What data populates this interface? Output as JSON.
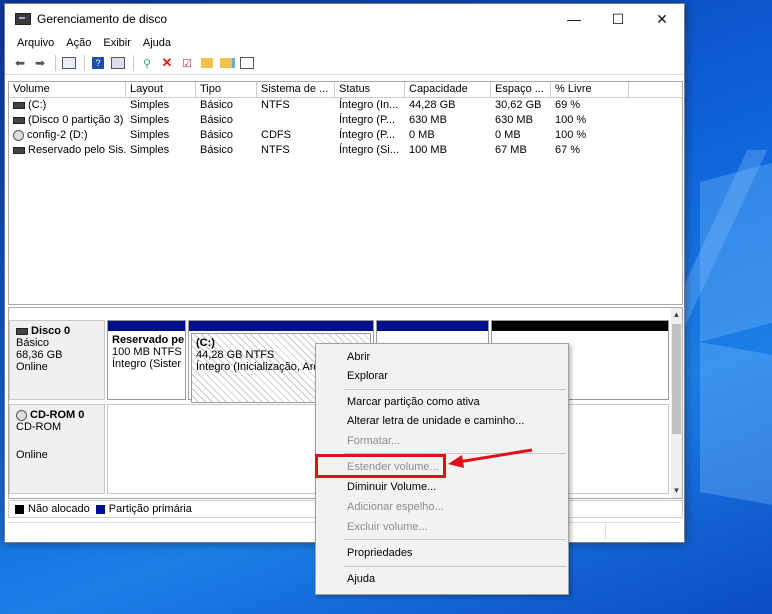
{
  "window": {
    "title": "Gerenciamento de disco",
    "controls": {
      "minimize": "—",
      "maximize": "☐",
      "close": "✕"
    }
  },
  "menubar": [
    "Arquivo",
    "Ação",
    "Exibir",
    "Ajuda"
  ],
  "table": {
    "headers": [
      "Volume",
      "Layout",
      "Tipo",
      "Sistema de ...",
      "Status",
      "Capacidade",
      "Espaço ...",
      "% Livre"
    ],
    "rows": [
      [
        "(C:)",
        "Simples",
        "Básico",
        "NTFS",
        "Íntegro (In...",
        "44,28 GB",
        "30,62 GB",
        "69 %"
      ],
      [
        "(Disco 0 partição 3)",
        "Simples",
        "Básico",
        "",
        "Íntegro (P...",
        "630 MB",
        "630 MB",
        "100 %"
      ],
      [
        "config-2 (D:)",
        "Simples",
        "Básico",
        "CDFS",
        "Íntegro (P...",
        "0 MB",
        "0 MB",
        "100 %"
      ],
      [
        "Reservado pelo Sis...",
        "Simples",
        "Básico",
        "NTFS",
        "Íntegro (Si...",
        "100 MB",
        "67 MB",
        "67 %"
      ]
    ]
  },
  "disks": {
    "disk0": {
      "name": "Disco 0",
      "type": "Básico",
      "size": "68,36 GB",
      "state": "Online",
      "partitions": {
        "reserved": {
          "title": "Reservado pe",
          "size": "100 MB NTFS",
          "status": "Íntegro (Sister"
        },
        "c": {
          "title": "(C:)",
          "size": "44,28 GB NTFS",
          "status": "Íntegro (Inicialização, Arqu"
        }
      }
    },
    "cdrom0": {
      "name": "CD-ROM 0",
      "type": "CD-ROM",
      "state": "Online"
    }
  },
  "legend": {
    "unallocated": "Não alocado",
    "primary": "Partição primária"
  },
  "context_menu": {
    "abrir": "Abrir",
    "explorar": "Explorar",
    "marcar": "Marcar partição como ativa",
    "alterar": "Alterar letra de unidade e caminho...",
    "formatar": "Formatar...",
    "estender": "Estender volume...",
    "diminuir": "Diminuir Volume...",
    "adicionar": "Adicionar espelho...",
    "excluir": "Excluir volume...",
    "propriedades": "Propriedades",
    "ajuda": "Ajuda"
  },
  "colors": {
    "primary_partition": "#00108c",
    "unallocated": "#000000",
    "highlight": "#e0101a"
  }
}
